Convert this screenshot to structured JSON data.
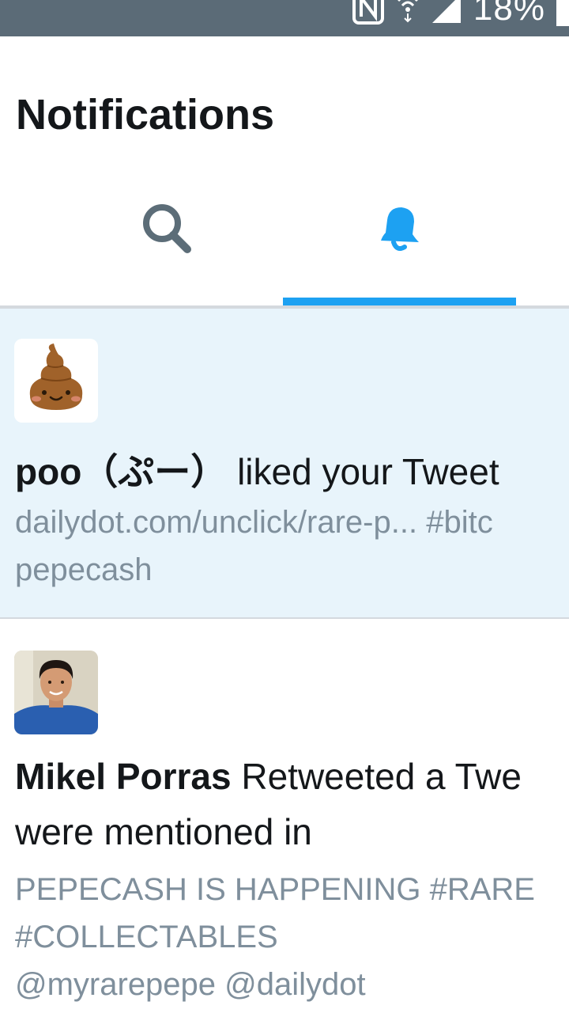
{
  "status_bar": {
    "battery_text": "18%",
    "icons": [
      "nfc-icon",
      "wifi-icon",
      "signal-icon",
      "battery-icon"
    ]
  },
  "header": {
    "title": "Notifications",
    "tabs": [
      {
        "icon": "search-icon",
        "active": false
      },
      {
        "icon": "bell-icon",
        "active": true
      }
    ],
    "accent_color": "#1da1f2"
  },
  "notifications": [
    {
      "avatar": "poo-emoji-avatar",
      "user": "poo（ぷー）",
      "action": " liked your Tweet",
      "snippet_line1": "dailydot.com/unclick/rare-p... #bitc",
      "snippet_line2": "pepecash",
      "highlighted": true
    },
    {
      "avatar": "profile-photo-avatar",
      "user": "Mikel Porras",
      "action_line1": " Retweeted a Twe",
      "action_line2": "were mentioned in",
      "snippet_line1": "PEPECASH IS HAPPENING #RARE",
      "snippet_line2": "#COLLECTABLES",
      "snippet_line3": "@myrarepepe @dailydot",
      "highlighted": false
    }
  ]
}
